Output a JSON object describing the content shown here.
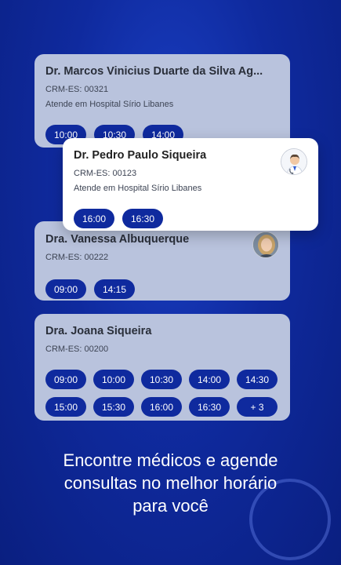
{
  "doctors": [
    {
      "name": "Dr. Marcos Vinicius Duarte da Silva Ag...",
      "crm": "CRM-ES: 00321",
      "place": "Atende em Hospital Sírio Libanes",
      "slots": [
        "10:00",
        "10:30",
        "14:00"
      ]
    },
    {
      "name": "Dr. Pedro Paulo Siqueira",
      "crm": "CRM-ES: 00123",
      "place": "Atende em Hospital Sírio Libanes",
      "slots": [
        "16:00",
        "16:30"
      ]
    },
    {
      "name": "Dra. Vanessa Albuquerque",
      "crm": "CRM-ES: 00222",
      "slots": [
        "09:00",
        "14:15"
      ]
    },
    {
      "name": "Dra. Joana Siqueira",
      "crm": "CRM-ES: 00200",
      "slots": [
        "09:00",
        "10:00",
        "10:30",
        "14:00",
        "14:30",
        "15:00",
        "15:30",
        "16:00",
        "16:30",
        "+ 3"
      ]
    }
  ],
  "tagline": {
    "line1": "Encontre médicos e agende",
    "line2": "consultas no melhor horário",
    "line3": "para você"
  },
  "colors": {
    "background": "#0f2a9e",
    "slot": "#0f2a9e",
    "card_dim": "#b9c3dd",
    "card_active": "#ffffff"
  },
  "icons": [
    "doctor-avatar-icon",
    "avatar"
  ]
}
